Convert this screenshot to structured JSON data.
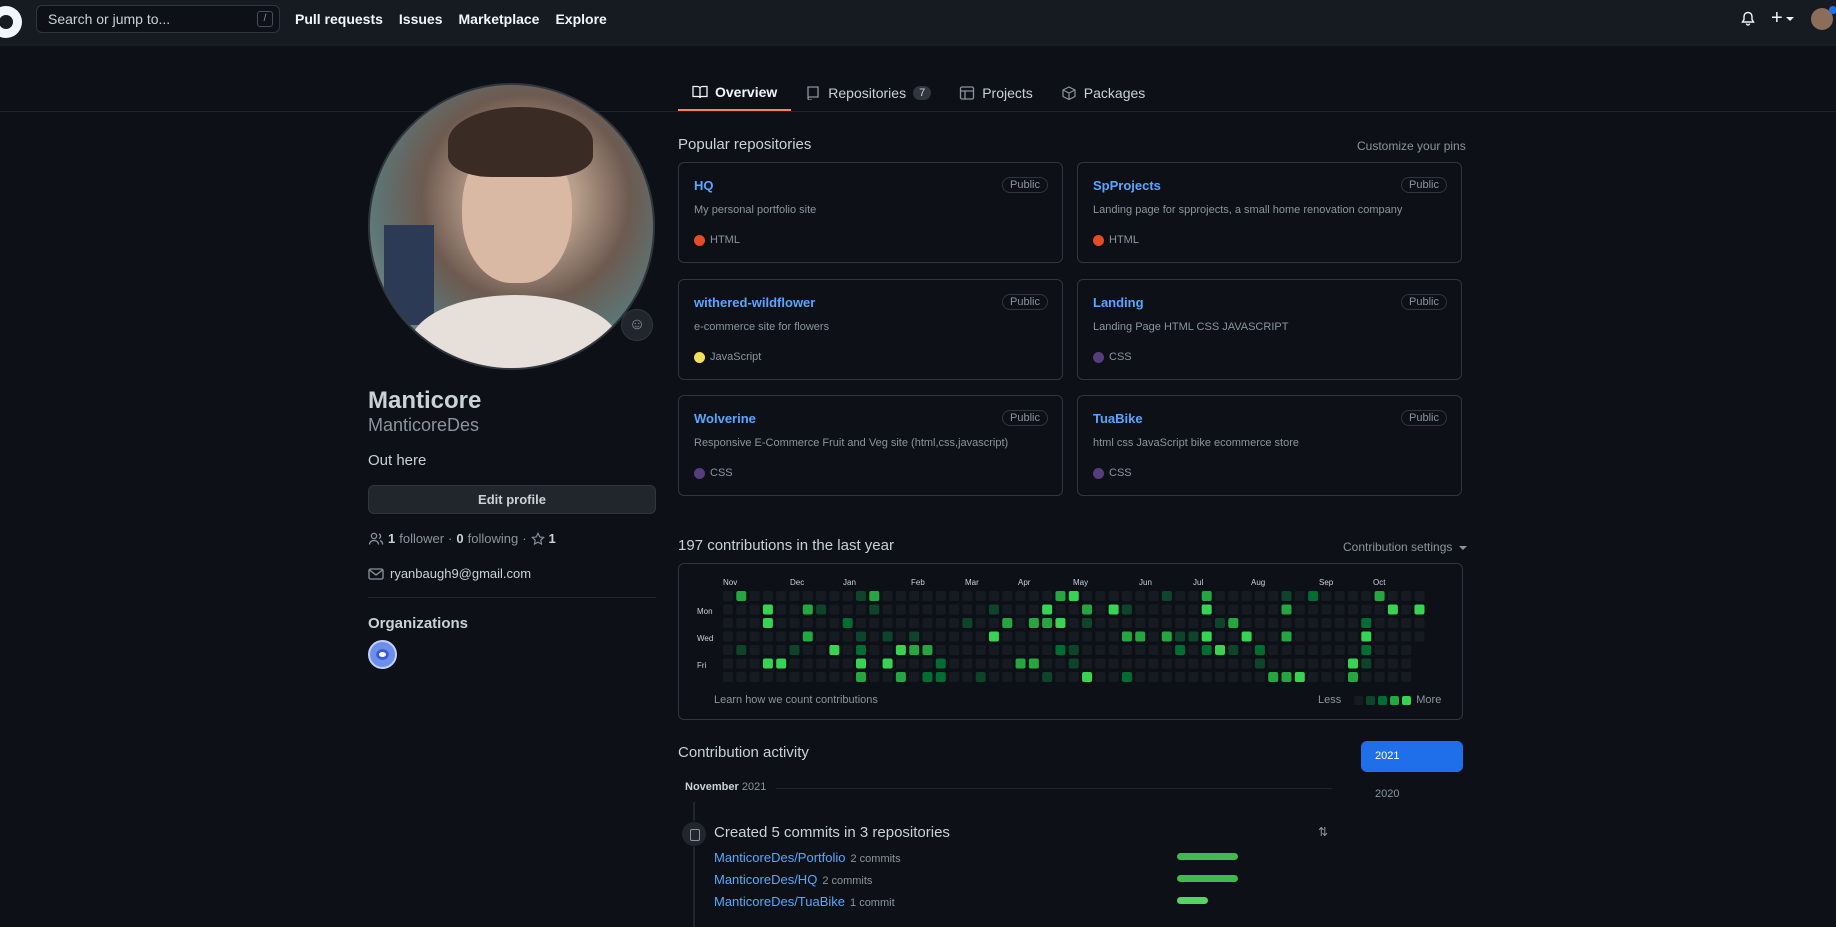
{
  "topbar": {
    "search_placeholder": "Search or jump to...",
    "slash_key": "/",
    "nav": [
      "Pull requests",
      "Issues",
      "Marketplace",
      "Explore"
    ],
    "icons": [
      "github-logo",
      "bell-icon",
      "plus-icon",
      "avatar"
    ]
  },
  "tabs": [
    {
      "label": "Overview",
      "icon": "book-icon",
      "active": true
    },
    {
      "label": "Repositories",
      "icon": "repo-icon",
      "count": "7"
    },
    {
      "label": "Projects",
      "icon": "project-icon"
    },
    {
      "label": "Packages",
      "icon": "package-icon"
    }
  ],
  "profile": {
    "name": "Manticore",
    "login": "ManticoreDes",
    "bio": "Out here",
    "edit_label": "Edit profile",
    "followers_count": "1",
    "followers_label": "follower",
    "following_count": "0",
    "following_label": "following",
    "stars_count": "1",
    "email": "ryanbaugh9@gmail.com",
    "orgs_title": "Organizations"
  },
  "popular": {
    "title": "Popular repositories",
    "customize": "Customize your pins",
    "repos": [
      {
        "name": "HQ",
        "badge": "Public",
        "desc": "My personal portfolio site",
        "lang": "HTML",
        "color": "#e34c26"
      },
      {
        "name": "SpProjects",
        "badge": "Public",
        "desc": "Landing page for spprojects, a small home renovation company",
        "lang": "HTML",
        "color": "#e34c26"
      },
      {
        "name": "withered-wildflower",
        "badge": "Public",
        "desc": "e-commerce site for flowers",
        "lang": "JavaScript",
        "color": "#f1e05a"
      },
      {
        "name": "Landing",
        "badge": "Public",
        "desc": "Landing Page HTML CSS JAVASCRIPT",
        "lang": "CSS",
        "color": "#563d7c"
      },
      {
        "name": "Wolverine",
        "badge": "Public",
        "desc": "Responsive E-Commerce Fruit and Veg site (html,css,javascript)",
        "lang": "CSS",
        "color": "#563d7c"
      },
      {
        "name": "TuaBike",
        "badge": "Public",
        "desc": "html css JavaScript bike ecommerce store",
        "lang": "CSS",
        "color": "#563d7c"
      }
    ]
  },
  "contributions": {
    "title": "197 contributions in the last year",
    "settings": "Contribution settings",
    "months": [
      "Nov",
      "Dec",
      "Jan",
      "Feb",
      "Mar",
      "Apr",
      "May",
      "Jun",
      "Jul",
      "Aug",
      "Sep",
      "Oct"
    ],
    "days": [
      "Mon",
      "Wed",
      "Fri"
    ],
    "learn": "Learn how we count contributions",
    "less": "Less",
    "more": "More",
    "levels": [
      "#161b22",
      "#0e4429",
      "#006d32",
      "#26a641",
      "#39d353"
    ]
  },
  "activity": {
    "title": "Contribution activity",
    "years": [
      "2021",
      "2020"
    ],
    "month": "November",
    "month_year": "2021",
    "summary": "Created 5 commits in 3 repositories",
    "rows": [
      {
        "repo": "ManticoreDes/Portfolio",
        "count": "2 commits",
        "share": 1.0
      },
      {
        "repo": "ManticoreDes/HQ",
        "count": "2 commits",
        "share": 1.0
      },
      {
        "repo": "ManticoreDes/TuaBike",
        "count": "1 commit",
        "share": 0.5
      }
    ]
  }
}
